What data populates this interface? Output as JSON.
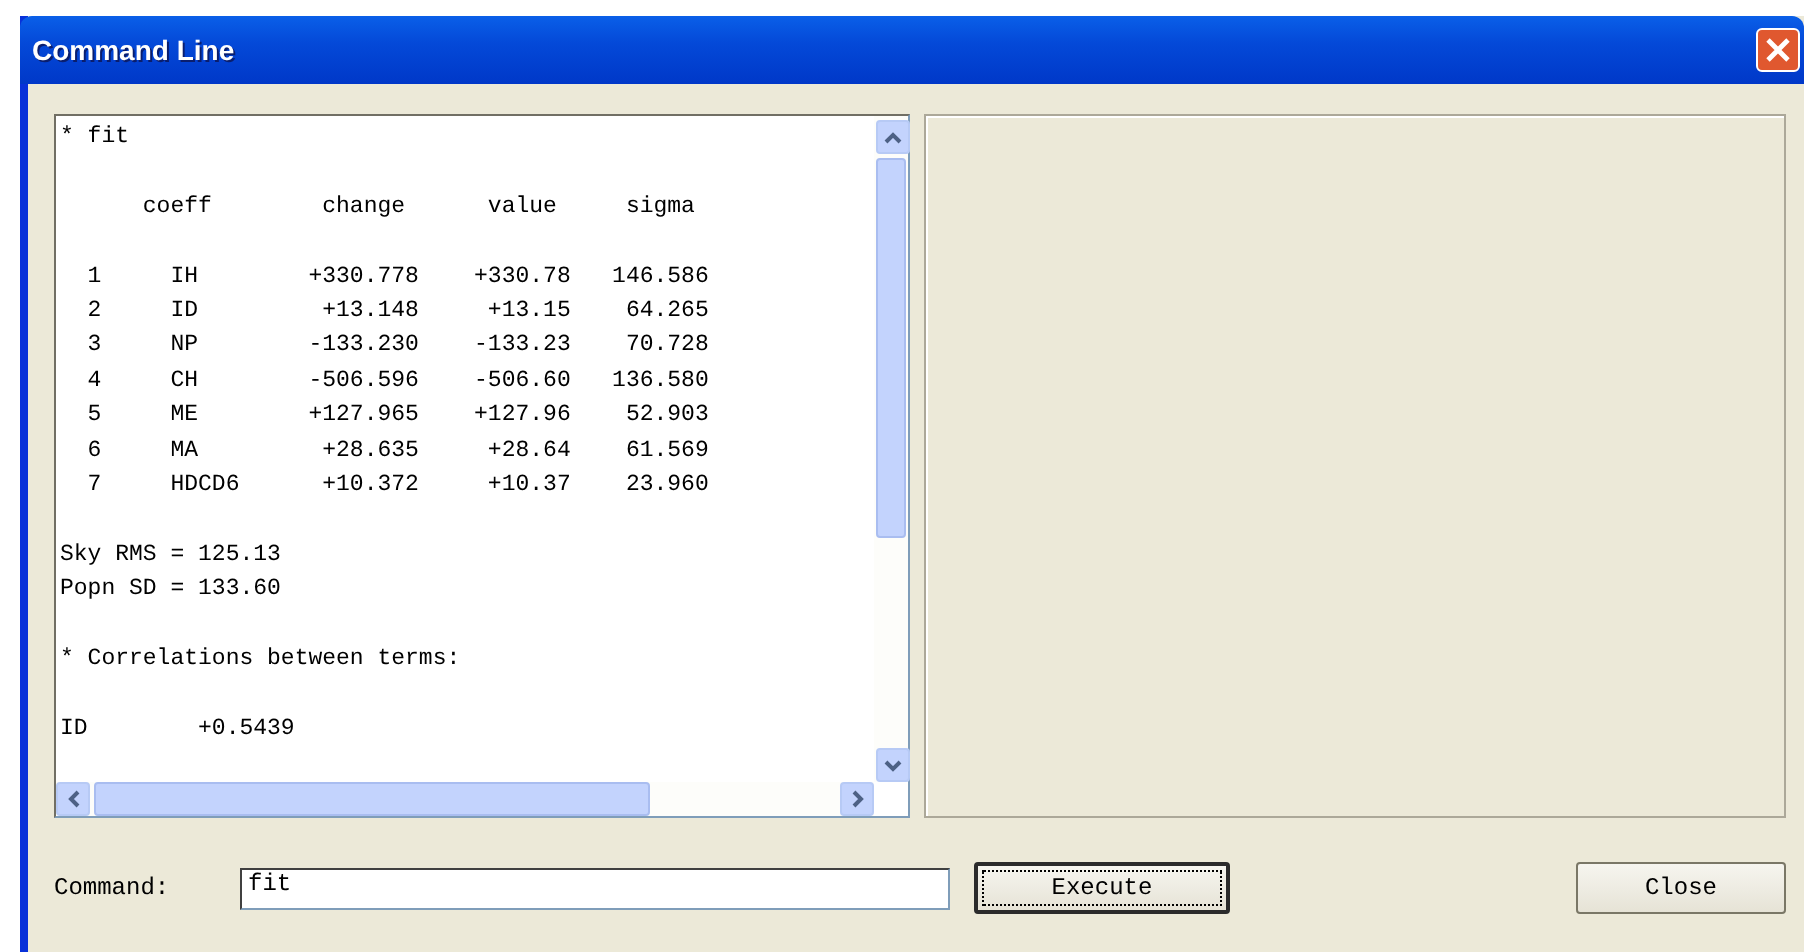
{
  "window": {
    "title": "Command Line"
  },
  "output": {
    "paragraphs": [
      [
        "* fit"
      ],
      [
        "      coeff        change      value     sigma"
      ],
      [
        "  1     IH        +330.778    +330.78   146.586",
        "  2     ID         +13.148     +13.15    64.265",
        "  3     NP        -133.230    -133.23    70.728",
        "  4     CH        -506.596    -506.60   136.580",
        "  5     ME        +127.965    +127.96    52.903",
        "  6     MA         +28.635     +28.64    61.569",
        "  7     HDCD6      +10.372     +10.37    23.960"
      ],
      [
        "Sky RMS = 125.13",
        "Popn SD = 133.60"
      ],
      [
        "* Correlations between terms:"
      ],
      [
        "ID        +0.5439"
      ]
    ]
  },
  "command": {
    "label": "Command:",
    "value": "fit"
  },
  "buttons": [
    {
      "label": "Execute",
      "focused": true
    },
    {
      "label": "Close",
      "focused": false
    }
  ]
}
